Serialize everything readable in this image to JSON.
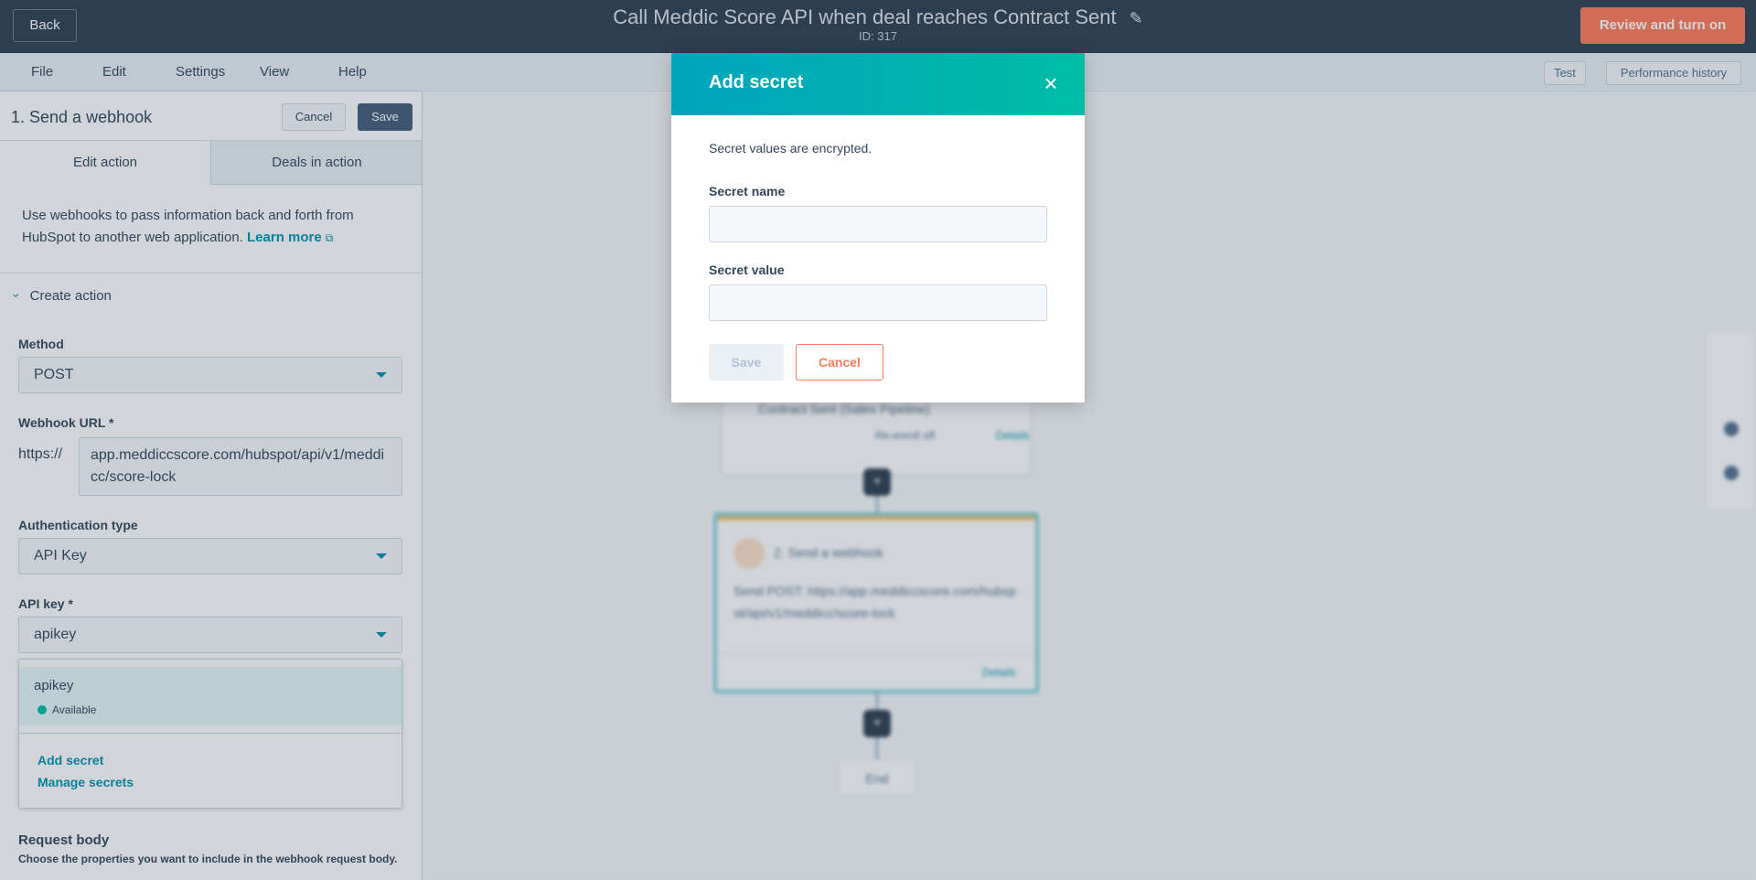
{
  "header": {
    "back_label": "Back",
    "workflow_title": "Call Meddic Score API when deal reaches Contract Sent",
    "workflow_subtitle": "ID: 317",
    "review_button_label": "Review and turn on"
  },
  "menubar": {
    "items": [
      "File",
      "Edit",
      "Settings",
      "View",
      "Help"
    ],
    "right_buttons": [
      "Test",
      "Performance history"
    ]
  },
  "panel": {
    "title": "1. Send a webhook",
    "cancel_label": "Cancel",
    "save_label": "Save",
    "tabs": [
      "Edit action",
      "Deals in action"
    ],
    "intro_text": "Use webhooks to pass information back and forth from HubSpot to another web application.",
    "learn_more_label": "Learn more",
    "section_label": "Create action",
    "method": {
      "label": "Method",
      "value": "POST"
    },
    "webhook_url": {
      "label": "Webhook URL *",
      "prefix": "https://",
      "value": "app.meddiccscore.com/hubspot/api/v1/meddicc/score-lock"
    },
    "auth_type": {
      "label": "Authentication type",
      "value": "API Key"
    },
    "api_key": {
      "label": "API key *",
      "value": "apikey",
      "options": [
        {
          "name": "apikey",
          "status": "Available"
        }
      ],
      "add_secret_label": "Add secret",
      "manage_secrets_label": "Manage secrets"
    },
    "request_body": {
      "title": "Request body",
      "description": "Choose the properties you want to include in the webhook request body."
    }
  },
  "canvas": {
    "node1_text": "Contract Sent (Sales Pipeline)",
    "node1_badge": "Re-enroll off",
    "node1_link": "Details",
    "node2_title": "2. Send a webhook",
    "node2_body": "Send POST: https://app.meddiccscore.com/hubspot/api/v1/meddicc/score-lock",
    "node2_link": "Details",
    "end_label": "End",
    "plus_label": "+"
  },
  "modal": {
    "title": "Add secret",
    "description": "Secret values are encrypted.",
    "secret_name_label": "Secret name",
    "secret_name_value": "",
    "secret_value_label": "Secret value",
    "secret_value_value": "",
    "save_label": "Save",
    "cancel_label": "Cancel"
  },
  "colors": {
    "header_bg": "#2d3e50",
    "accent_teal": "#00a4bd",
    "modal_header_end": "#00bda5",
    "accent_orange": "#ff7a59",
    "status_available": "#00bda5",
    "link": "#0091ae"
  },
  "icons": {
    "close": "close-icon",
    "caret": "caret-down-icon",
    "chevron": "chevron-down-icon",
    "external": "external-link-icon",
    "pencil": "pencil-icon",
    "status_dot": "status-dot-icon"
  }
}
